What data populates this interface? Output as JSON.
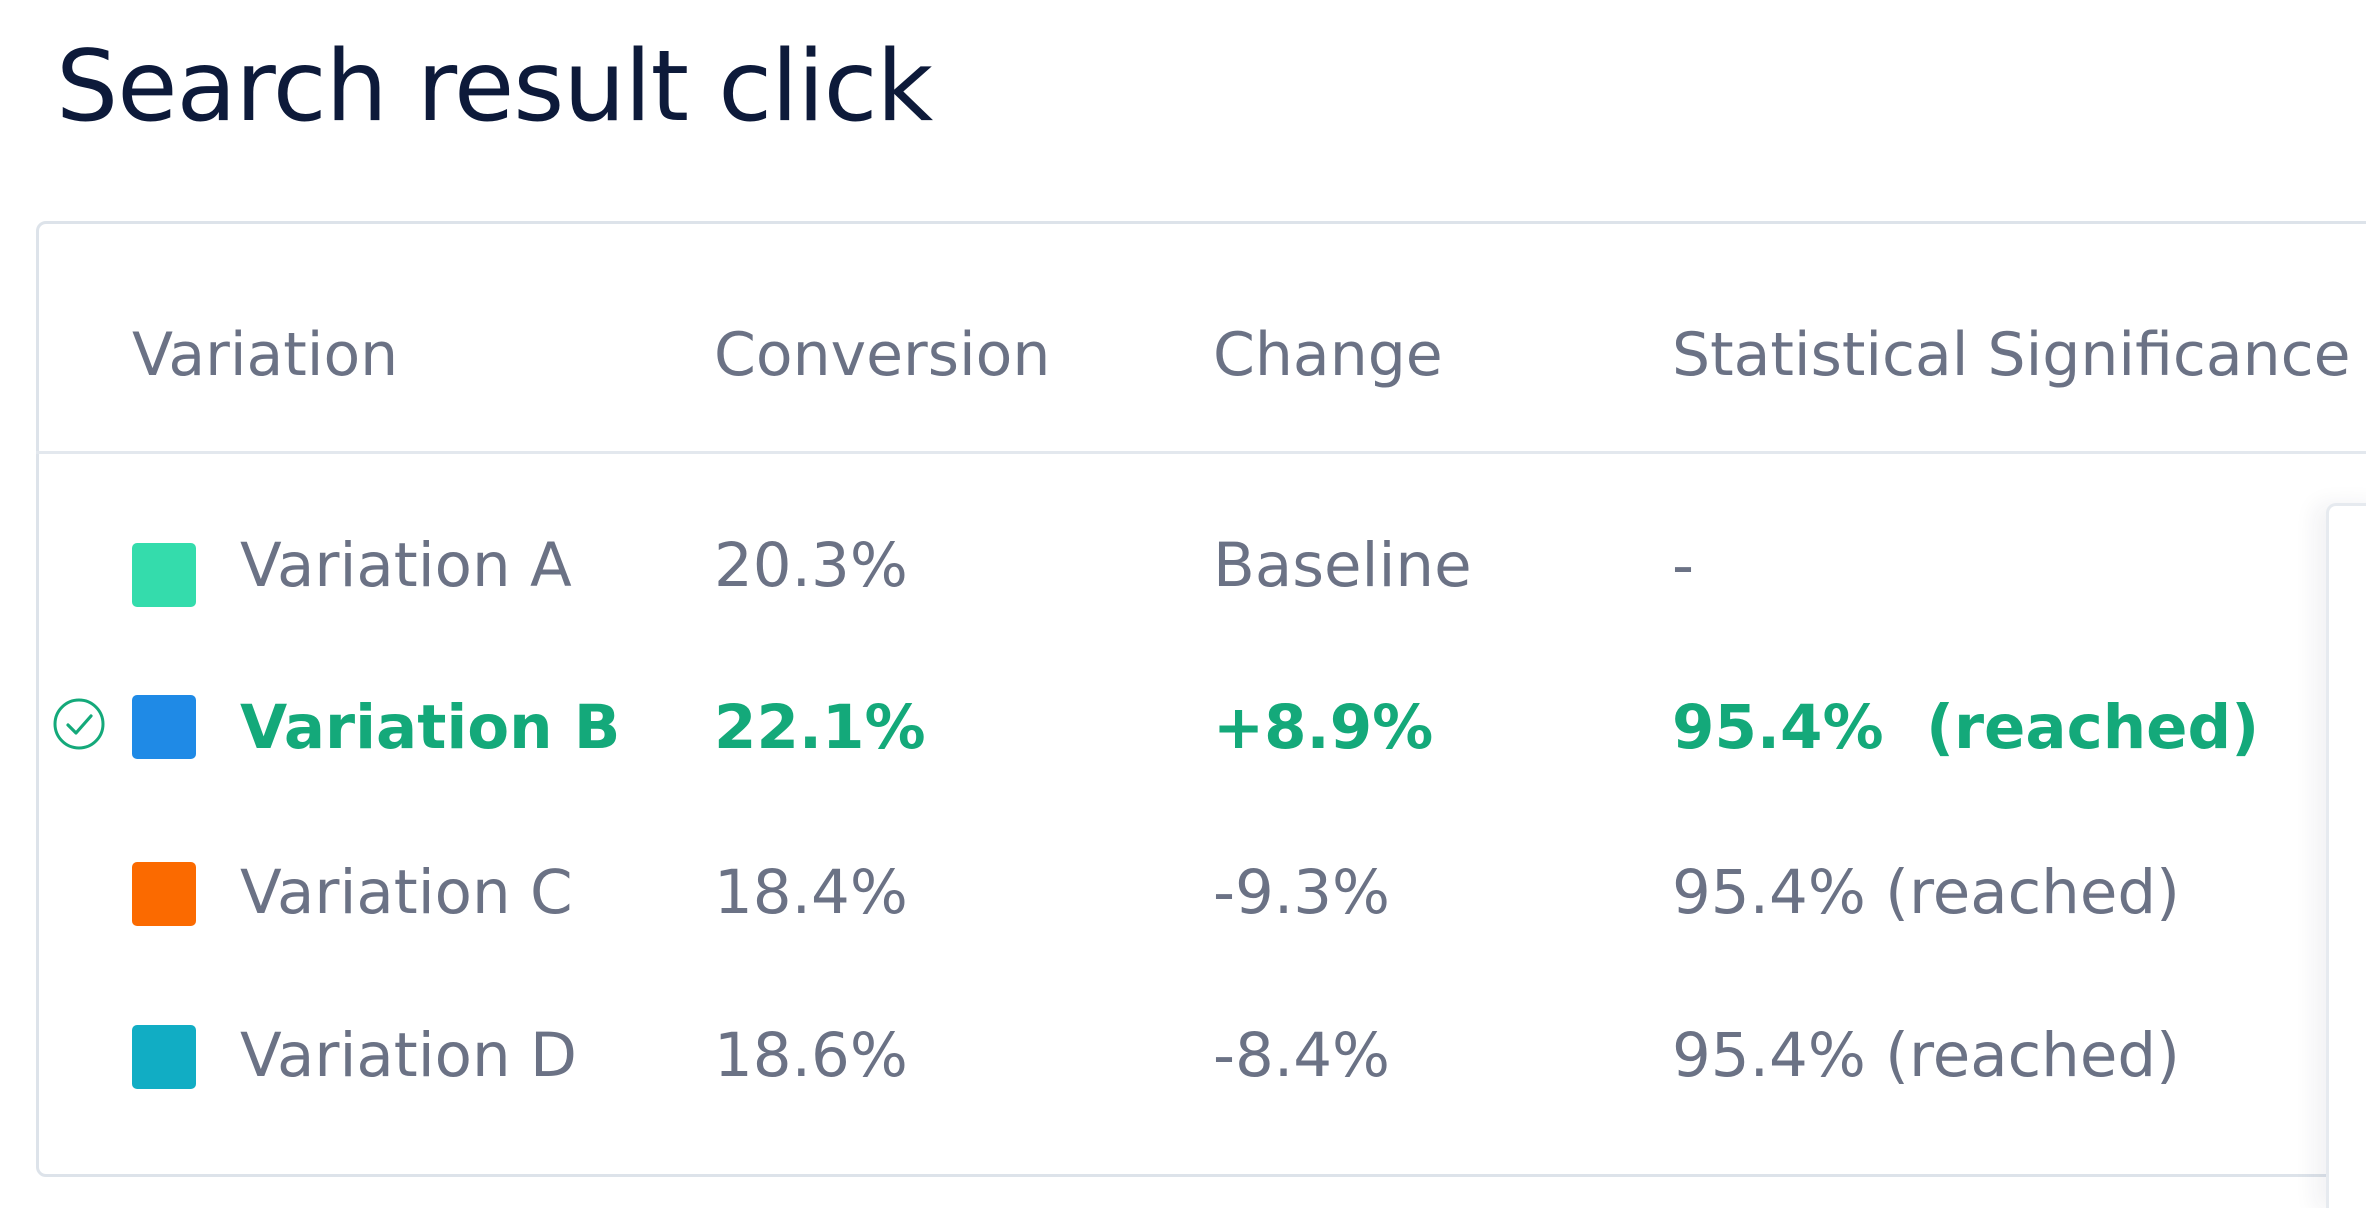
{
  "title": "Search result click",
  "table": {
    "headers": {
      "variation": "Variation",
      "conversion": "Conversion",
      "change": "Change",
      "significance": "Statistical Significance"
    },
    "rows": [
      {
        "name": "Variation A",
        "color": "#34dcac",
        "conversion": "20.3%",
        "change": "Baseline",
        "significance": "-",
        "winner": false
      },
      {
        "name": "Variation B",
        "color": "#1f8ae6",
        "conversion": "22.1%",
        "change": "+8.9%",
        "significance": "95.4%  (reached)",
        "winner": true,
        "winner_icon": "check-circle-icon"
      },
      {
        "name": "Variation C",
        "color": "#fb6a00",
        "conversion": "18.4%",
        "change": "-9.3%",
        "significance": "95.4% (reached)",
        "winner": false
      },
      {
        "name": "Variation D",
        "color": "#11adc4",
        "conversion": "18.6%",
        "change": "-8.4%",
        "significance": "95.4% (reached)",
        "winner": false
      }
    ]
  },
  "colors": {
    "winner_text": "#14a97a",
    "title_text": "#0d1a3a",
    "muted_text": "#6b7285",
    "border": "#dde3ea"
  }
}
